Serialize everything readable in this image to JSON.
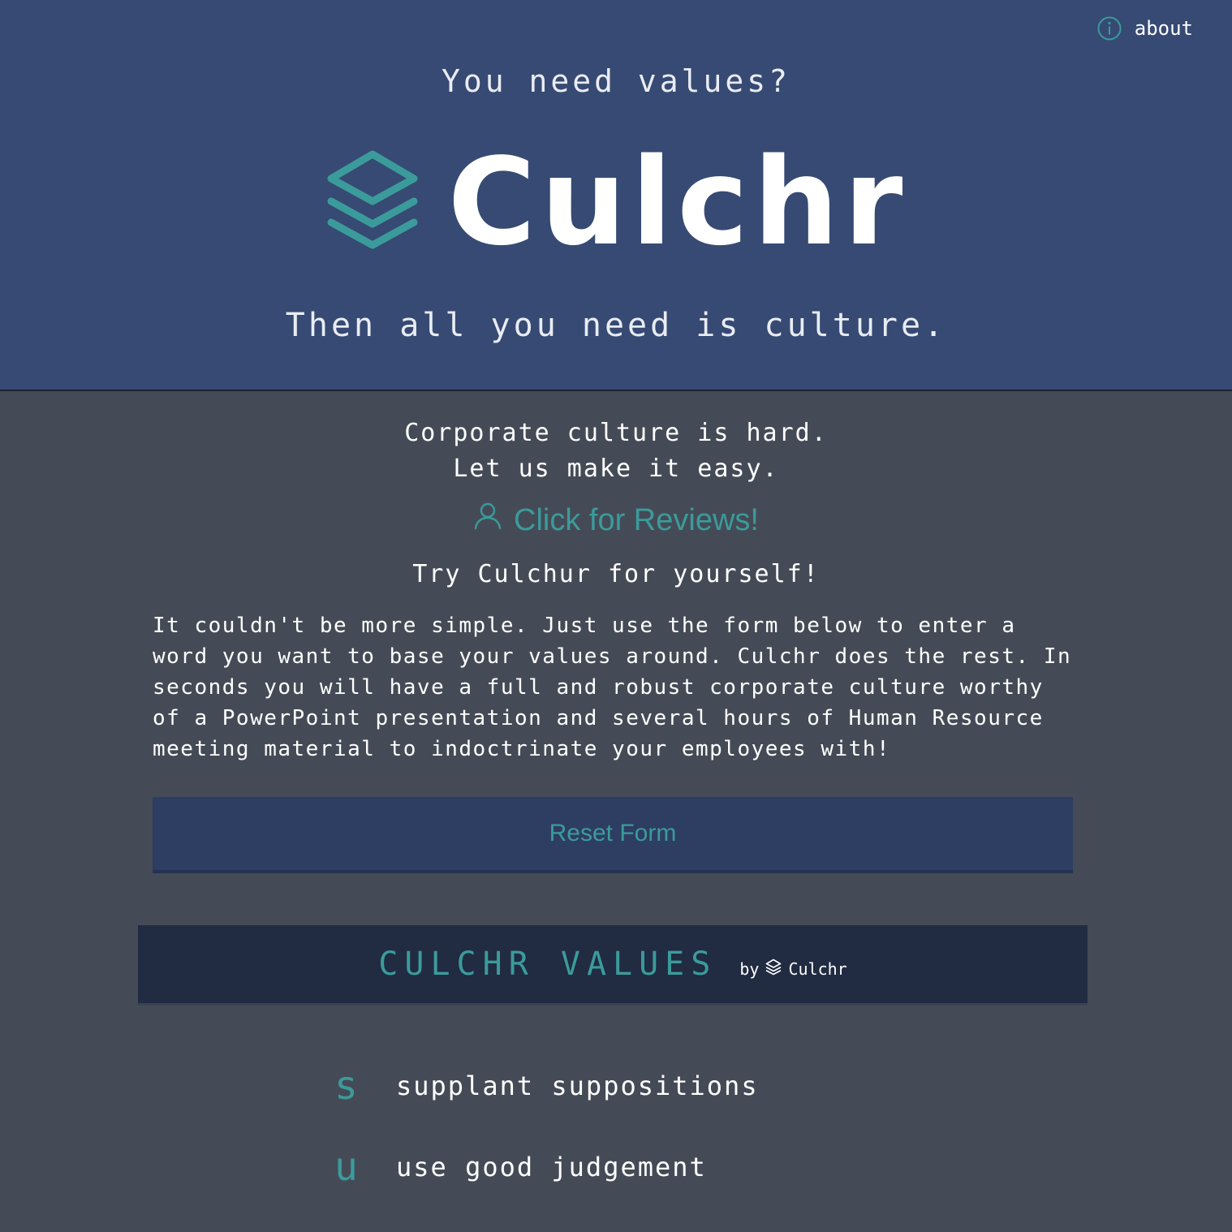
{
  "nav": {
    "about_label": "about"
  },
  "hero": {
    "question": "You need values?",
    "logo_text": "Culchr",
    "tagline": "Then all you need is culture."
  },
  "intro": {
    "line1": "Corporate culture is hard.",
    "line2": "Let us make it easy.",
    "reviews_link": "Click for Reviews!",
    "try_heading": "Try Culchur for yourself!",
    "description": "It couldn't be more simple. Just use the form below to enter a word you want to base your values around. Culchr does the rest. In seconds you will have a full and robust corporate culture worthy of a PowerPoint presentation and several hours of Human Resource meeting material to indoctrinate your employees with!"
  },
  "form": {
    "reset_label": "Reset Form"
  },
  "values": {
    "title": "CULCHR VALUES",
    "by_label": "by",
    "brand": "Culchr",
    "items": [
      {
        "letter": "s",
        "text": "supplant suppositions"
      },
      {
        "letter": "u",
        "text": "use good judgement"
      }
    ]
  },
  "colors": {
    "hero_bg": "#364a73",
    "page_bg": "#454b56",
    "accent": "#3b9b9b",
    "button_bg": "#2e3d62",
    "values_header_bg": "#212b42"
  }
}
